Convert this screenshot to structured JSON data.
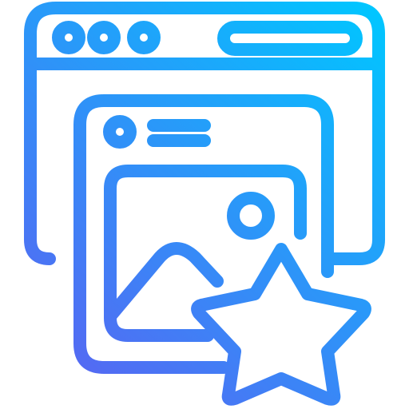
{
  "icon": {
    "name": "browser-image-favorite-icon",
    "gradient": {
      "start": "#00c6ff",
      "end": "#5865f2"
    }
  }
}
